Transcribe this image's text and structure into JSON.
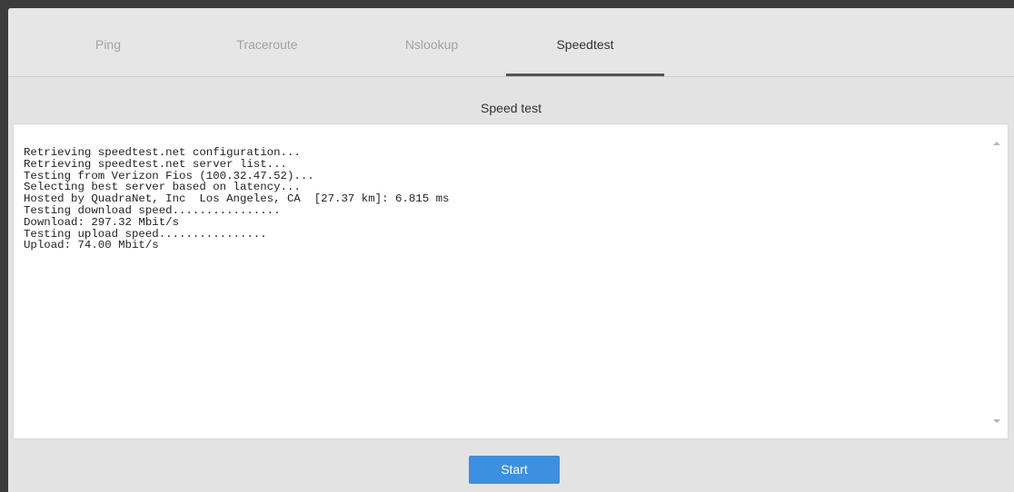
{
  "tabs": [
    {
      "label": "Ping"
    },
    {
      "label": "Traceroute"
    },
    {
      "label": "Nslookup"
    },
    {
      "label": "Speedtest"
    }
  ],
  "active_tab": "Speedtest",
  "section": {
    "title": "Speed test"
  },
  "output": {
    "lines": [
      "Retrieving speedtest.net configuration...",
      "Retrieving speedtest.net server list...",
      "Testing from Verizon Fios (100.32.47.52)...",
      "Selecting best server based on latency...",
      "Hosted by QuadraNet, Inc  Los Angeles, CA  [27.37 km]: 6.815 ms",
      "Testing download speed................",
      "Download: 297.32 Mbit/s",
      "Testing upload speed................",
      "Upload: 74.00 Mbit/s"
    ]
  },
  "actions": {
    "start_label": "Start"
  },
  "colors": {
    "accent": "#3d8fdf",
    "tab_inactive": "#a3a3a3",
    "tab_active": "#333333",
    "background": "#e3e3e3"
  },
  "icons": {
    "scroll_up": "scroll-up-arrow",
    "scroll_down": "scroll-down-arrow"
  }
}
